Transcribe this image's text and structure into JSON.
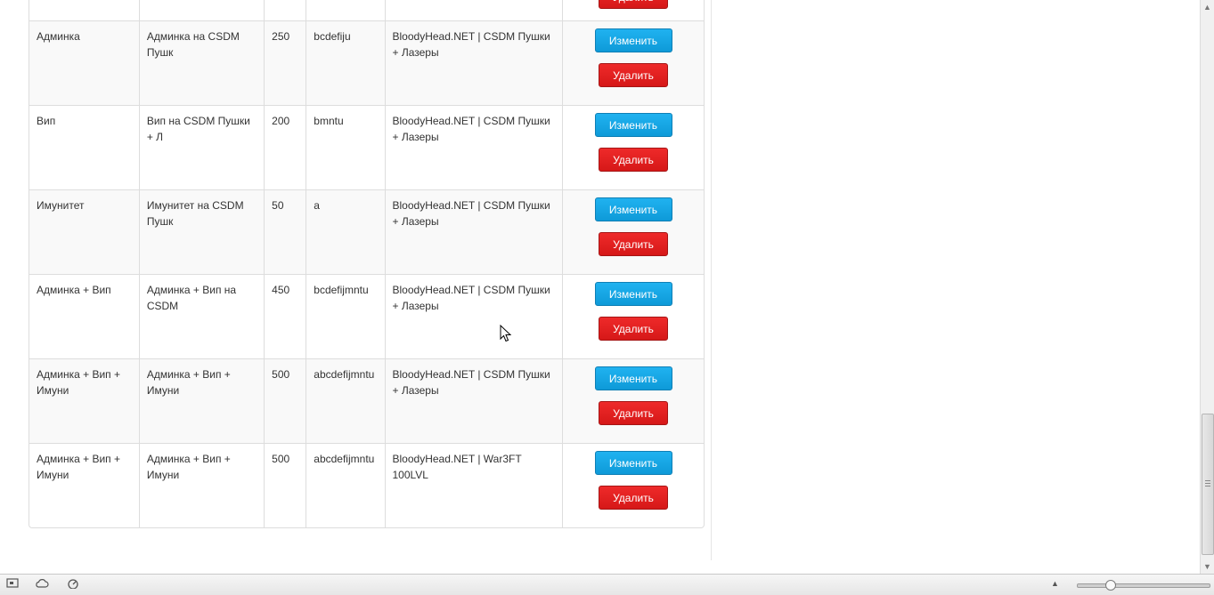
{
  "buttons": {
    "edit": "Изменить",
    "delete": "Удалить"
  },
  "rows": [
    {
      "name": "Админка",
      "description": "Админка на CSDM Пушк",
      "price": "250",
      "flags": "bcdefiju",
      "server": "BloodyHead.NET | CSDM Пушки + Лазеры"
    },
    {
      "name": "Вип",
      "description": "Вип на CSDM Пушки + Л",
      "price": "200",
      "flags": "bmntu",
      "server": "BloodyHead.NET | CSDM Пушки + Лазеры"
    },
    {
      "name": "Имунитет",
      "description": "Имунитет на CSDM Пушк",
      "price": "50",
      "flags": "a",
      "server": "BloodyHead.NET | CSDM Пушки + Лазеры"
    },
    {
      "name": "Админка + Вип",
      "description": "Админка + Вип на CSDM",
      "price": "450",
      "flags": "bcdefijmntu",
      "server": "BloodyHead.NET | CSDM Пушки + Лазеры"
    },
    {
      "name": "Админка + Вип + Имуни",
      "description": "Админка + Вип + Имуни",
      "price": "500",
      "flags": "abcdefijmntu",
      "server": "BloodyHead.NET | CSDM Пушки + Лазеры"
    },
    {
      "name": "Админка + Вип + Имуни",
      "description": "Админка + Вип + Имуни",
      "price": "500",
      "flags": "abcdefijmntu",
      "server": "BloodyHead.NET | War3FT 100LVL"
    }
  ],
  "statusbar": {
    "icons": [
      "screen-icon",
      "cloud-icon",
      "speedometer-icon",
      "zoom-menu-arrow-icon"
    ],
    "zoom_level_fraction": 0.25
  },
  "colors": {
    "edit_button": "#1aa7e6",
    "delete_button": "#e02020",
    "stripe": "#f9f9f9",
    "border": "#dddddd"
  }
}
